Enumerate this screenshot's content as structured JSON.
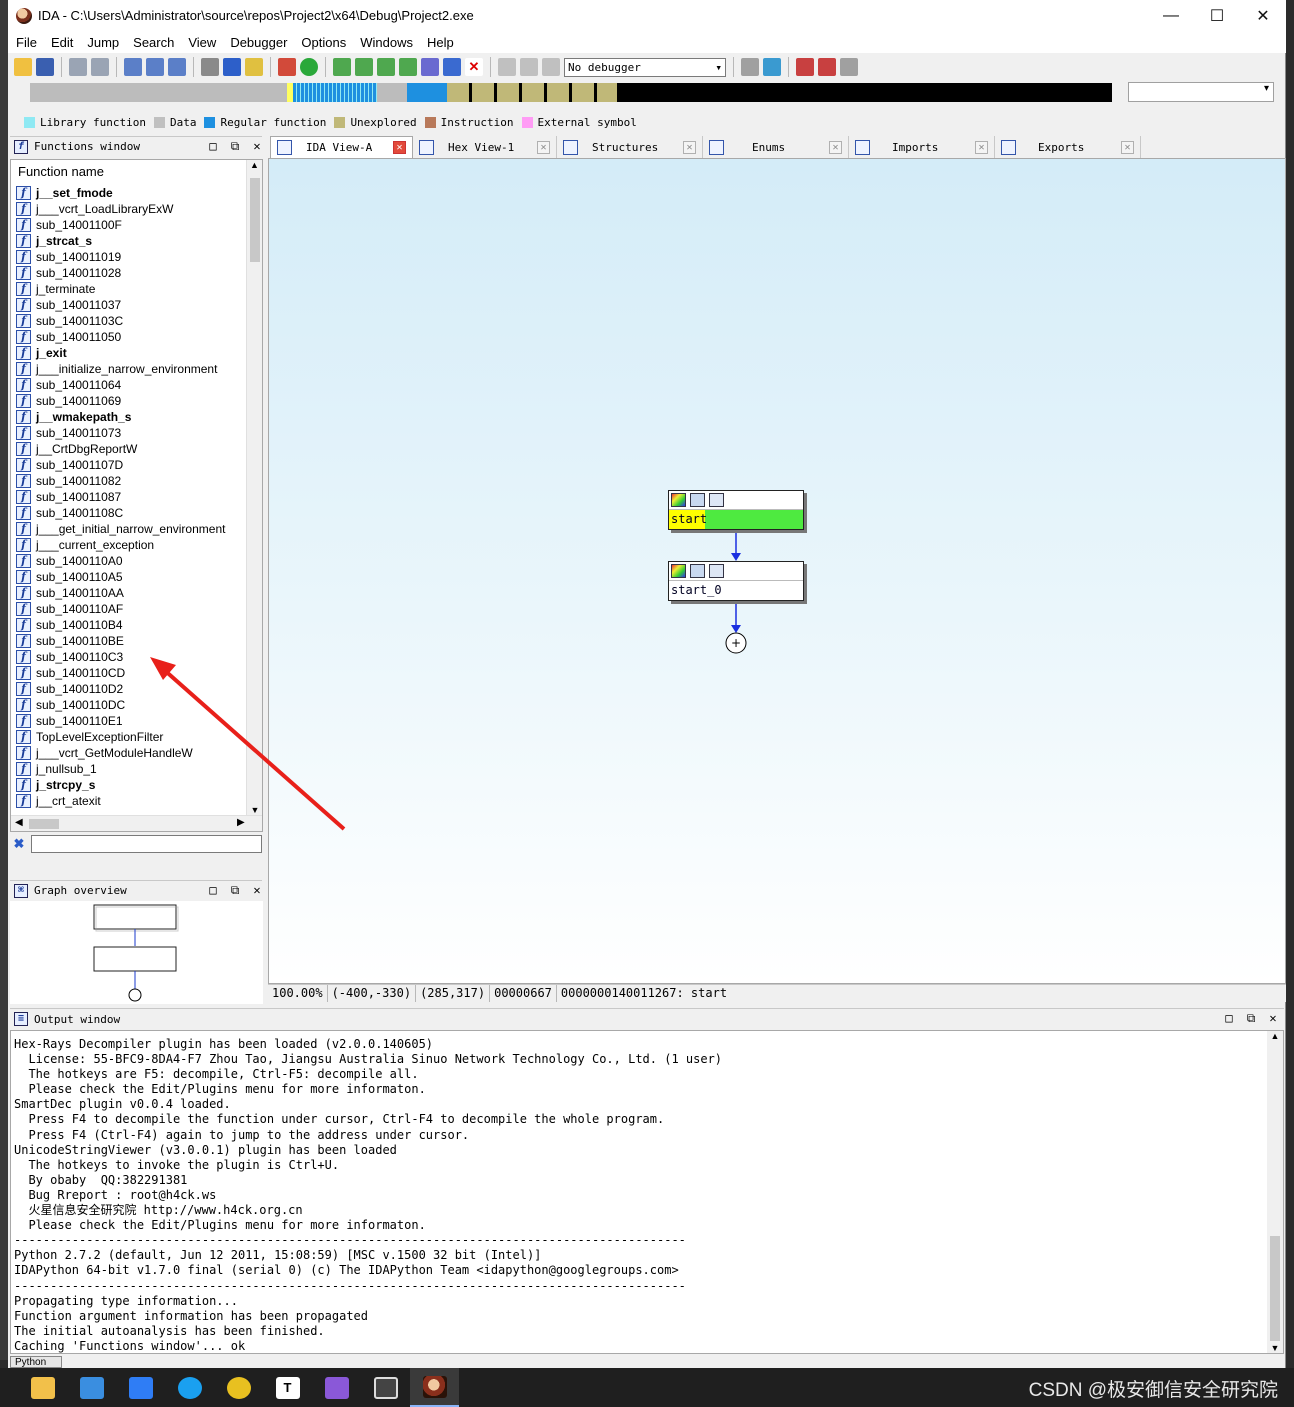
{
  "window": {
    "title": "IDA - C:\\Users\\Administrator\\source\\repos\\Project2\\x64\\Debug\\Project2.exe",
    "minimize": "—",
    "maximize": "☐",
    "close": "✕"
  },
  "menu": [
    "File",
    "Edit",
    "Jump",
    "Search",
    "View",
    "Debugger",
    "Options",
    "Windows",
    "Help"
  ],
  "toolbar": {
    "debugger_select": "No debugger"
  },
  "legend": [
    {
      "label": "Library function",
      "color": "#8fe9f3"
    },
    {
      "label": "Data",
      "color": "#c0c0c0"
    },
    {
      "label": "Regular function",
      "color": "#1e90e0"
    },
    {
      "label": "Unexplored",
      "color": "#c0b878"
    },
    {
      "label": "Instruction",
      "color": "#b8795a"
    },
    {
      "label": "External symbol",
      "color": "#ff9cf5"
    }
  ],
  "functions_window": {
    "title": "Functions window",
    "header": "Function name",
    "items": [
      {
        "name": "j__set_fmode",
        "bold": true
      },
      {
        "name": "j___vcrt_LoadLibraryExW",
        "bold": false
      },
      {
        "name": "sub_14001100F",
        "bold": false
      },
      {
        "name": "j_strcat_s",
        "bold": true
      },
      {
        "name": "sub_140011019",
        "bold": false
      },
      {
        "name": "sub_140011028",
        "bold": false
      },
      {
        "name": "j_terminate",
        "bold": false
      },
      {
        "name": "sub_140011037",
        "bold": false
      },
      {
        "name": "sub_14001103C",
        "bold": false
      },
      {
        "name": "sub_140011050",
        "bold": false
      },
      {
        "name": "j_exit",
        "bold": true
      },
      {
        "name": "j___initialize_narrow_environment",
        "bold": false
      },
      {
        "name": "sub_140011064",
        "bold": false
      },
      {
        "name": "sub_140011069",
        "bold": false
      },
      {
        "name": "j__wmakepath_s",
        "bold": true
      },
      {
        "name": "sub_140011073",
        "bold": false
      },
      {
        "name": "j__CrtDbgReportW",
        "bold": false
      },
      {
        "name": "sub_14001107D",
        "bold": false
      },
      {
        "name": "sub_140011082",
        "bold": false
      },
      {
        "name": "sub_140011087",
        "bold": false
      },
      {
        "name": "sub_14001108C",
        "bold": false
      },
      {
        "name": "j___get_initial_narrow_environment",
        "bold": false
      },
      {
        "name": "j___current_exception",
        "bold": false
      },
      {
        "name": "sub_1400110A0",
        "bold": false
      },
      {
        "name": "sub_1400110A5",
        "bold": false
      },
      {
        "name": "sub_1400110AA",
        "bold": false
      },
      {
        "name": "sub_1400110AF",
        "bold": false
      },
      {
        "name": "sub_1400110B4",
        "bold": false
      },
      {
        "name": "sub_1400110BE",
        "bold": false
      },
      {
        "name": "sub_1400110C3",
        "bold": false
      },
      {
        "name": "sub_1400110CD",
        "bold": false
      },
      {
        "name": "sub_1400110D2",
        "bold": false
      },
      {
        "name": "sub_1400110DC",
        "bold": false
      },
      {
        "name": "sub_1400110E1",
        "bold": false
      },
      {
        "name": "TopLevelExceptionFilter",
        "bold": false
      },
      {
        "name": "j___vcrt_GetModuleHandleW",
        "bold": false
      },
      {
        "name": "j_nullsub_1",
        "bold": false
      },
      {
        "name": "j_strcpy_s",
        "bold": true
      },
      {
        "name": "j__crt_atexit",
        "bold": false
      }
    ]
  },
  "graph_overview": {
    "title": "Graph overview"
  },
  "tabs": [
    {
      "label": "IDA View-A",
      "active": true
    },
    {
      "label": "Hex View-1",
      "active": false
    },
    {
      "label": "Structures",
      "active": false
    },
    {
      "label": "Enums",
      "active": false
    },
    {
      "label": "Imports",
      "active": false
    },
    {
      "label": "Exports",
      "active": false
    }
  ],
  "graph": {
    "nodes": [
      {
        "label": "start",
        "highlight": true
      },
      {
        "label": "start_0",
        "highlight": false
      }
    ],
    "plus_label": "+"
  },
  "status_bar": [
    "100.00%",
    "(-400,-330)",
    "(285,317)",
    "00000667",
    "0000000140011267: start"
  ],
  "output_window": {
    "title": "Output window",
    "lines": [
      "Hex-Rays Decompiler plugin has been loaded (v2.0.0.140605)",
      "  License: 55-BFC9-8DA4-F7 Zhou Tao, Jiangsu Australia Sinuo Network Technology Co., Ltd. (1 user)",
      "  The hotkeys are F5: decompile, Ctrl-F5: decompile all.",
      "  Please check the Edit/Plugins menu for more informaton.",
      "SmartDec plugin v0.0.4 loaded.",
      "  Press F4 to decompile the function under cursor, Ctrl-F4 to decompile the whole program.",
      "  Press F4 (Ctrl-F4) again to jump to the address under cursor.",
      "UnicodeStringViewer (v3.0.0.1) plugin has been loaded",
      "  The hotkeys to invoke the plugin is Ctrl+U.",
      "  By obaby  QQ:382291381",
      "  Bug Rreport : root@h4ck.ws",
      "  火星信息安全研究院 http://www.h4ck.org.cn",
      "  Please check the Edit/Plugins menu for more informaton.",
      "---------------------------------------------------------------------------------------------",
      "Python 2.7.2 (default, Jun 12 2011, 15:08:59) [MSC v.1500 32 bit (Intel)]",
      "IDAPython 64-bit v1.7.0 final (serial 0) (c) The IDAPython Team <idapython@googlegroups.com>",
      "---------------------------------------------------------------------------------------------",
      "Propagating type information...",
      "Function argument information has been propagated",
      "The initial autoanalysis has been finished.",
      "Caching 'Functions window'... ok"
    ],
    "python_label": "Python"
  },
  "watermark": "CSDN @极安御信安全研究院"
}
